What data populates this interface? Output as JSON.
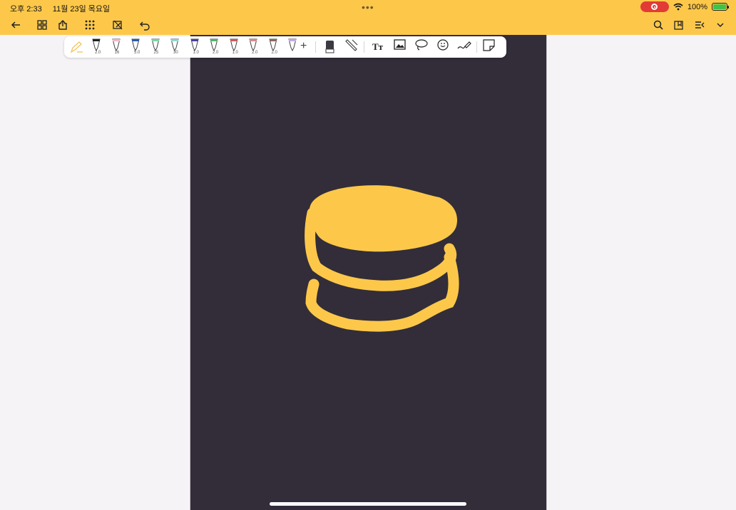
{
  "status": {
    "time": "오후 2:33",
    "date": "11월 23일 목요일",
    "battery": "100%"
  },
  "pen_toolbar": {
    "pens": [
      {
        "name": "pen-black",
        "size": "2.0",
        "color": "#222222"
      },
      {
        "name": "pen-pink",
        "size": "16",
        "color": "#f4b7c6"
      },
      {
        "name": "pen-blue",
        "size": "5.0",
        "color": "#2c5aa8"
      },
      {
        "name": "highlighter-green",
        "size": "25",
        "color": "#7fd6a0"
      },
      {
        "name": "highlighter-teal",
        "size": "30",
        "color": "#8fd8d4"
      },
      {
        "name": "pen-purple",
        "size": "1.0",
        "color": "#4b3ea0"
      },
      {
        "name": "pen-green",
        "size": "2.0",
        "color": "#57b26a"
      },
      {
        "name": "pen-red",
        "size": "1.0",
        "color": "#d05a5a"
      },
      {
        "name": "pen-rose",
        "size": "2.0",
        "color": "#d98b8b"
      },
      {
        "name": "pen-brown",
        "size": "2.0",
        "color": "#8b6a5a"
      },
      {
        "name": "pen-lavender",
        "size": "",
        "color": "#c9a8e8"
      }
    ],
    "add_label": "+",
    "text_tool_label": "Tт"
  },
  "colors": {
    "accent": "#fdc84a",
    "page_background": "#322d38",
    "drawing_stroke": "#fdc84a",
    "record": "#e23b36"
  }
}
